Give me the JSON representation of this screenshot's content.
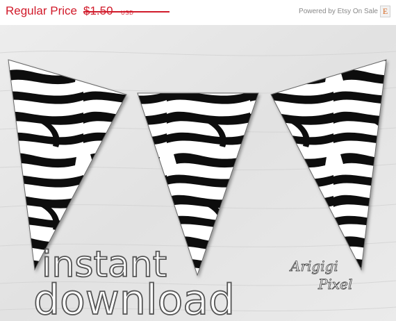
{
  "banner": {
    "price_label": "Regular Price",
    "price_value": "$1.50",
    "price_currency": "USD",
    "powered_text": "Powered by Etsy On Sale",
    "etsy_letter": "E"
  },
  "artwork": {
    "line1": "instant",
    "line2": "download",
    "signature_line1": "Arigigi",
    "signature_line2": "Pixel"
  },
  "colors": {
    "accent_red": "#d11a2a",
    "etsy_orange": "#d5641c",
    "wood_light": "#e4e4e4",
    "zebra_black": "#111111"
  }
}
